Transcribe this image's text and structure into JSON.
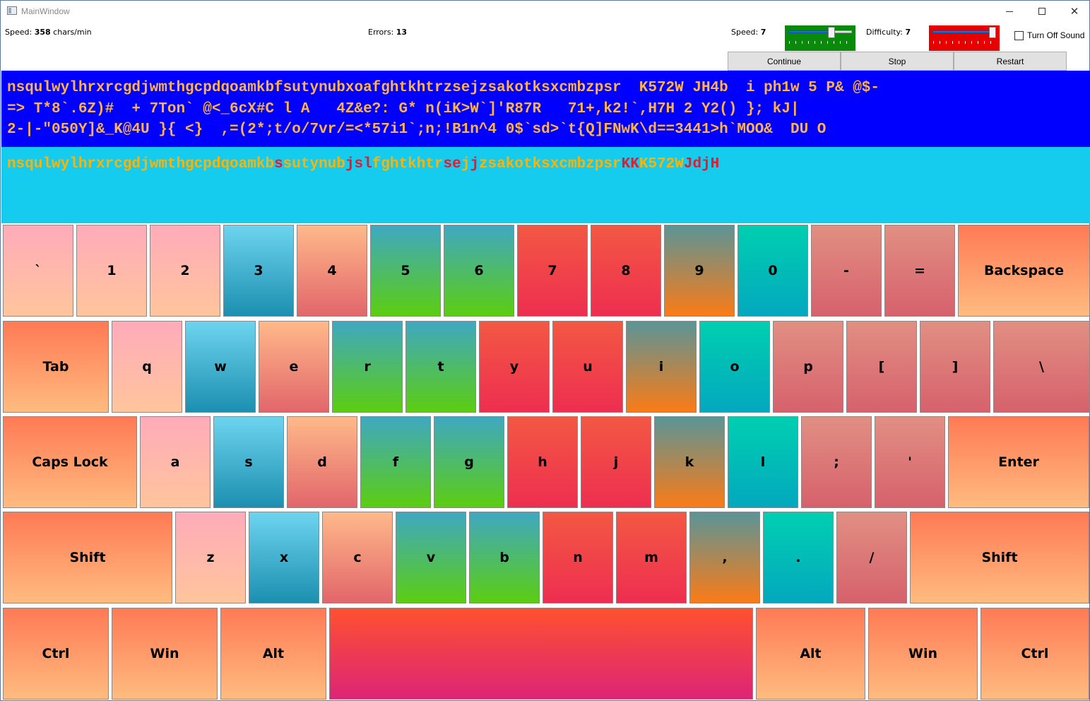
{
  "window": {
    "title": "MainWindow"
  },
  "stats": {
    "speed_label": "Speed:",
    "speed_value": "358",
    "speed_unit": "chars/min",
    "errors_label": "Errors:",
    "errors_value": "13"
  },
  "settings": {
    "speed_label": "Speed:",
    "speed_value": "7",
    "speed_level": 0.7,
    "speed_color": "#0a8a0a",
    "difficulty_label": "Difficulty:",
    "difficulty_value": "7",
    "difficulty_level": 1.0,
    "difficulty_color": "#e60000",
    "sound_label": "Turn Off Sound",
    "sound_checked": false
  },
  "controls": {
    "continue": "Continue",
    "stop": "Stop",
    "restart": "Restart"
  },
  "target_text": [
    "nsqulwylhrxrcgdjwmthgcpdqoamkbfsutynubxoafghtkhtrzsejzsakotksxcmbzpsr  K572W JH4b  i ph1w 5 P& @$-",
    "=> T*8`.6Z)#  + 7Ton` @<_6cX#C l A   4Z&e?: G* n(iK>W`]'R87R   71+,k2!`,H7H 2 Y2() }; kJ|",
    "2-|-\"050Y]&_K@4U }{ <}  ,=(2*;t/o/7vr/=<*57i1`;n;!B1n^4 0$`sd>`t{Q]FNwK\\d==3441>h`MOO&  DU O"
  ],
  "typed_segments": [
    {
      "text": "nsqulwylhrxrcgdjwmthgcpdqoamkb",
      "ok": true
    },
    {
      "text": "s",
      "ok": false
    },
    {
      "text": "sutynub",
      "ok": true
    },
    {
      "text": "jsl",
      "ok": false
    },
    {
      "text": "fghtkhtr",
      "ok": true
    },
    {
      "text": "se",
      "ok": false
    },
    {
      "text": "j",
      "ok": true
    },
    {
      "text": "j",
      "ok": false
    },
    {
      "text": "zsakotksxcmbzpsr",
      "ok": true
    },
    {
      "text": "KK",
      "ok": false
    },
    {
      "text": "K572W",
      "ok": true
    },
    {
      "text": "JdjH",
      "ok": false
    }
  ],
  "keyboard": {
    "rows": [
      [
        {
          "label": "`",
          "name": "key-backtick",
          "color": "pink"
        },
        {
          "label": "1",
          "name": "key-1",
          "color": "pink"
        },
        {
          "label": "2",
          "name": "key-2",
          "color": "pink"
        },
        {
          "label": "3",
          "name": "key-3",
          "color": "blue"
        },
        {
          "label": "4",
          "name": "key-4",
          "color": "peach"
        },
        {
          "label": "5",
          "name": "key-5",
          "color": "green"
        },
        {
          "label": "6",
          "name": "key-6",
          "color": "green"
        },
        {
          "label": "7",
          "name": "key-7",
          "color": "red"
        },
        {
          "label": "8",
          "name": "key-8",
          "color": "red"
        },
        {
          "label": "9",
          "name": "key-9",
          "color": "teal-orange"
        },
        {
          "label": "0",
          "name": "key-0",
          "color": "aqua"
        },
        {
          "label": "-",
          "name": "key-minus",
          "color": "rose"
        },
        {
          "label": "=",
          "name": "key-equals",
          "color": "rose"
        },
        {
          "label": "Backspace",
          "name": "key-backspace",
          "color": "orange"
        }
      ],
      [
        {
          "label": "Tab",
          "name": "key-tab",
          "color": "orange"
        },
        {
          "label": "q",
          "name": "key-q",
          "color": "pink"
        },
        {
          "label": "w",
          "name": "key-w",
          "color": "blue"
        },
        {
          "label": "e",
          "name": "key-e",
          "color": "peach"
        },
        {
          "label": "r",
          "name": "key-r",
          "color": "green"
        },
        {
          "label": "t",
          "name": "key-t",
          "color": "green"
        },
        {
          "label": "y",
          "name": "key-y",
          "color": "red"
        },
        {
          "label": "u",
          "name": "key-u",
          "color": "red"
        },
        {
          "label": "i",
          "name": "key-i",
          "color": "teal-orange"
        },
        {
          "label": "o",
          "name": "key-o",
          "color": "aqua"
        },
        {
          "label": "p",
          "name": "key-p",
          "color": "rose"
        },
        {
          "label": "[",
          "name": "key-left-bracket",
          "color": "rose"
        },
        {
          "label": "]",
          "name": "key-right-bracket",
          "color": "rose"
        },
        {
          "label": "\\",
          "name": "key-backslash",
          "color": "rose"
        }
      ],
      [
        {
          "label": "Caps Lock",
          "name": "key-caps-lock",
          "color": "orange"
        },
        {
          "label": "a",
          "name": "key-a",
          "color": "pink"
        },
        {
          "label": "s",
          "name": "key-s",
          "color": "blue"
        },
        {
          "label": "d",
          "name": "key-d",
          "color": "peach"
        },
        {
          "label": "f",
          "name": "key-f",
          "color": "green"
        },
        {
          "label": "g",
          "name": "key-g",
          "color": "green"
        },
        {
          "label": "h",
          "name": "key-h",
          "color": "red"
        },
        {
          "label": "j",
          "name": "key-j",
          "color": "red"
        },
        {
          "label": "k",
          "name": "key-k",
          "color": "teal-orange"
        },
        {
          "label": "l",
          "name": "key-l",
          "color": "aqua"
        },
        {
          "label": ";",
          "name": "key-semicolon",
          "color": "rose"
        },
        {
          "label": "'",
          "name": "key-quote",
          "color": "rose"
        },
        {
          "label": "Enter",
          "name": "key-enter",
          "color": "orange"
        }
      ],
      [
        {
          "label": "Shift",
          "name": "key-left-shift",
          "color": "orange"
        },
        {
          "label": "z",
          "name": "key-z",
          "color": "pink"
        },
        {
          "label": "x",
          "name": "key-x",
          "color": "blue"
        },
        {
          "label": "c",
          "name": "key-c",
          "color": "peach"
        },
        {
          "label": "v",
          "name": "key-v",
          "color": "green"
        },
        {
          "label": "b",
          "name": "key-b",
          "color": "green"
        },
        {
          "label": "n",
          "name": "key-n",
          "color": "red"
        },
        {
          "label": "m",
          "name": "key-m",
          "color": "red"
        },
        {
          "label": ",",
          "name": "key-comma",
          "color": "teal-orange"
        },
        {
          "label": ".",
          "name": "key-period",
          "color": "aqua"
        },
        {
          "label": "/",
          "name": "key-slash",
          "color": "rose"
        },
        {
          "label": "Shift",
          "name": "key-right-shift",
          "color": "orange"
        }
      ],
      [
        {
          "label": "Ctrl",
          "name": "key-left-ctrl",
          "color": "orange"
        },
        {
          "label": "Win",
          "name": "key-left-win",
          "color": "orange"
        },
        {
          "label": "Alt",
          "name": "key-left-alt",
          "color": "orange"
        },
        {
          "label": "",
          "name": "key-space",
          "color": "space"
        },
        {
          "label": "Alt",
          "name": "key-right-alt",
          "color": "orange"
        },
        {
          "label": "Win",
          "name": "key-right-win",
          "color": "orange"
        },
        {
          "label": "Ctrl",
          "name": "key-right-ctrl",
          "color": "orange"
        }
      ]
    ]
  }
}
